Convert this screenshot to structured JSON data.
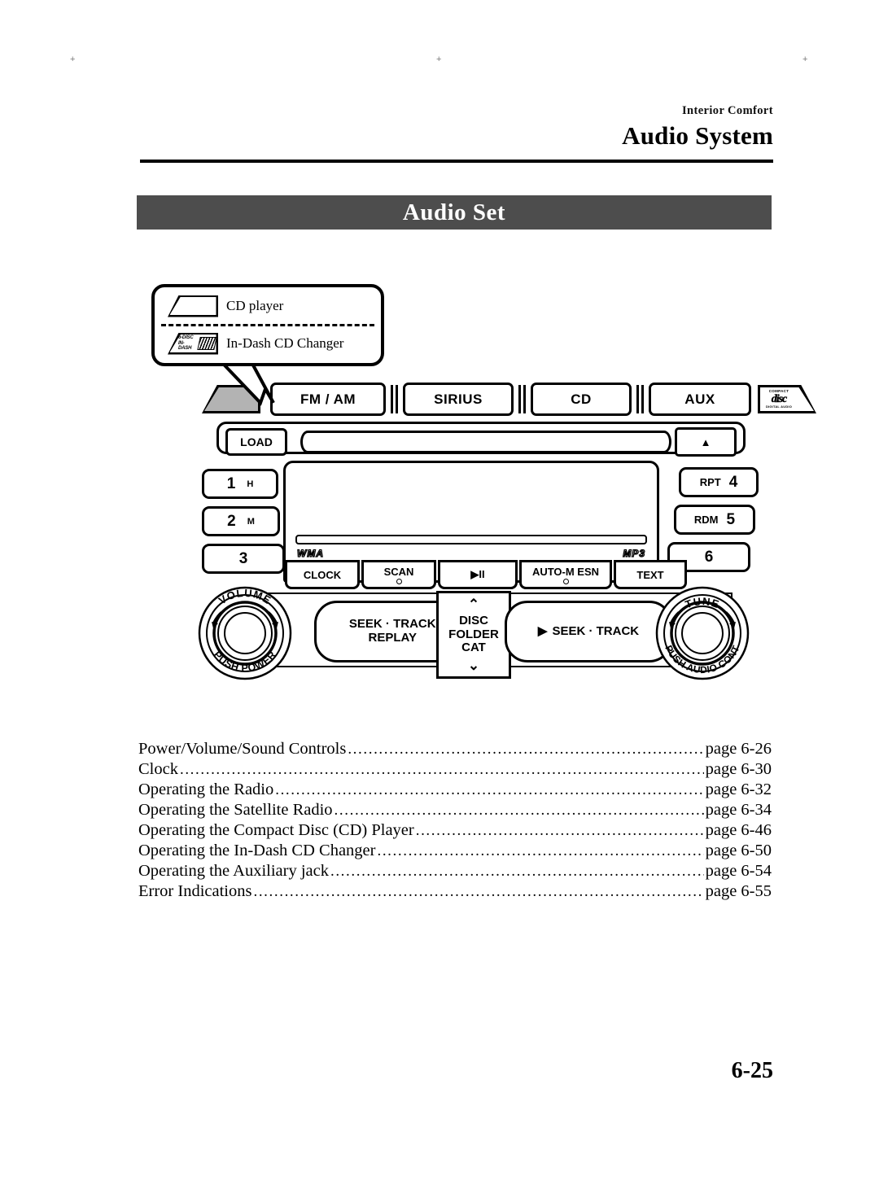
{
  "header": {
    "kicker": "Interior Comfort",
    "title": "Audio System"
  },
  "banner": {
    "title": "Audio Set"
  },
  "callout": {
    "rows": [
      {
        "icon": "cd-player-trapezoid-icon",
        "label": "CD player"
      },
      {
        "icon": "6-disc-in-dash-icon",
        "label": "In-Dash CD Changer",
        "icon_text_line1": "6-DISC",
        "icon_text_line2": "IN-DASH"
      }
    ]
  },
  "radio": {
    "source_buttons": [
      {
        "label": "FM / AM"
      },
      {
        "label": "SIRIUS"
      },
      {
        "label": "CD"
      },
      {
        "label": "AUX"
      }
    ],
    "cd_logo": {
      "top": "COMPACT",
      "mark": "disc",
      "bottom": "DIGITAL AUDIO"
    },
    "load_button": "LOAD",
    "eject_button": "▲",
    "presets_left": [
      {
        "num": "1",
        "sub": "H"
      },
      {
        "num": "2",
        "sub": "M"
      },
      {
        "num": "3",
        "sub": ""
      }
    ],
    "presets_right": [
      {
        "pre": "RPT",
        "num": "4"
      },
      {
        "pre": "RDM",
        "num": "5"
      },
      {
        "pre": "",
        "num": "6"
      }
    ],
    "display_formats": {
      "left": "WMA",
      "right": "MP3"
    },
    "function_keys": [
      {
        "label": "CLOCK",
        "dot": false
      },
      {
        "label": "SCAN",
        "dot": true
      },
      {
        "label": "▶II",
        "dot": false
      },
      {
        "label": "AUTO-M  ESN",
        "dot": true
      },
      {
        "label": "TEXT",
        "dot": false
      }
    ],
    "left_knob": {
      "top": "VOLUME",
      "bottom": "PUSH POWER"
    },
    "right_knob": {
      "top": "TUNE",
      "bottom": "PUSH AUDIO CONT"
    },
    "seek_left": {
      "line1": "SEEK · TRACK",
      "line2": "REPLAY",
      "arrow": "◀"
    },
    "seek_right": {
      "label": "SEEK · TRACK",
      "arrow": "▶"
    },
    "disc_pad": {
      "up": "⌃",
      "line1": "DISC",
      "line2": "FOLDER",
      "line3": "CAT",
      "down": "⌄"
    }
  },
  "toc": [
    {
      "title": "Power/Volume/Sound Controls",
      "page": "page 6-26"
    },
    {
      "title": "Clock",
      "page": "page 6-30"
    },
    {
      "title": "Operating the Radio",
      "page": "page 6-32"
    },
    {
      "title": "Operating the Satellite Radio",
      "page": "page 6-34"
    },
    {
      "title": "Operating the Compact Disc (CD) Player",
      "page": "page 6-46"
    },
    {
      "title": "Operating the In-Dash CD Changer",
      "page": "page 6-50"
    },
    {
      "title": "Operating the Auxiliary jack",
      "page": "page 6-54"
    },
    {
      "title": "Error Indications",
      "page": "page 6-55"
    }
  ],
  "page_number": "6-25",
  "colors": {
    "banner_bg": "#4d4d4d",
    "banner_text": "#ffffff",
    "ink": "#000000",
    "button_gray": "#b3b3b3"
  }
}
